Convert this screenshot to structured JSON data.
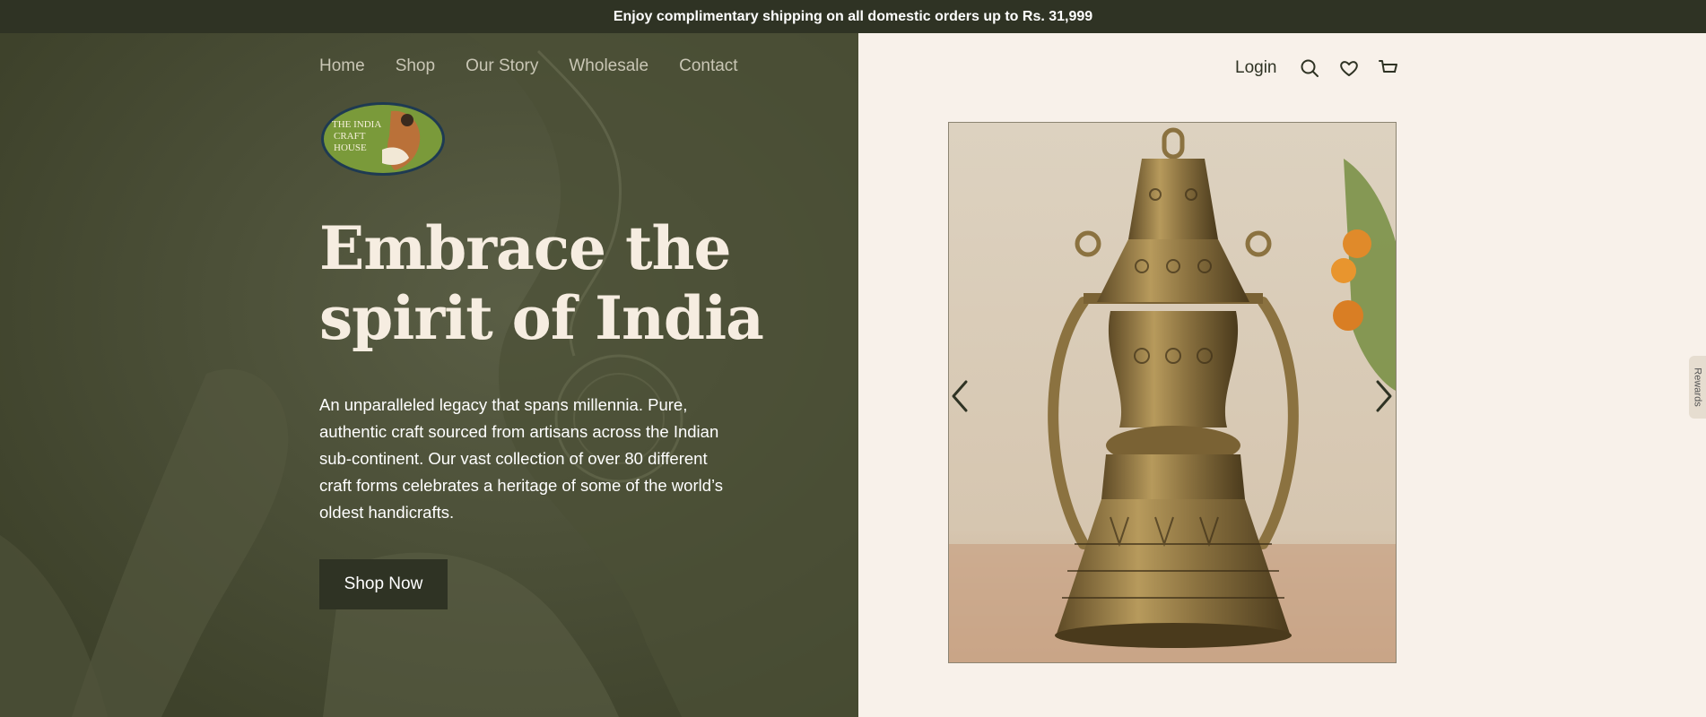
{
  "announcement": {
    "text": "Enjoy complimentary shipping on all domestic orders up to Rs. 31,999"
  },
  "nav": {
    "items": [
      {
        "label": "Home"
      },
      {
        "label": "Shop"
      },
      {
        "label": "Our Story"
      },
      {
        "label": "Wholesale"
      },
      {
        "label": "Contact"
      }
    ]
  },
  "logo": {
    "lines": [
      "THE INDIA",
      "CRAFT",
      "HOUSE"
    ]
  },
  "hero": {
    "headline_line1": "Embrace the",
    "headline_line2": "spirit of India",
    "description": "An unparalleled legacy that spans millennia. Pure, authentic craft sourced from artisans across the Indian sub-continent. Our vast collection of over 80 different craft forms celebrates a heritage of some of the world’s oldest handicrafts.",
    "cta_label": "Shop Now"
  },
  "header_right": {
    "login_label": "Login",
    "icons": [
      "search-icon",
      "heart-icon",
      "cart-icon"
    ]
  },
  "rewards": {
    "label": "Rewards"
  },
  "colors": {
    "announcement_bg": "#2f3324",
    "hero_left_bg": "#43472f",
    "hero_right_bg": "#f8f1ea",
    "cta_bg": "#2f3324",
    "headline": "#f6ede1"
  }
}
